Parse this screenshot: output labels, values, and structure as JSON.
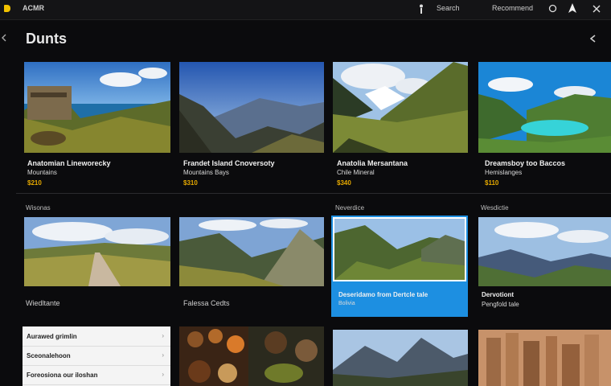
{
  "topbar": {
    "app_name": "ACMR",
    "nav_1": "Search",
    "nav_2": "Recommend"
  },
  "page": {
    "title": "Dunts"
  },
  "row1": [
    {
      "title": "Anatomian Lineworecky",
      "subtitle": "Mountains",
      "price": "$210"
    },
    {
      "title": "Frandet Island Cnoversoty",
      "subtitle": "Mountains Bays",
      "price": "$310"
    },
    {
      "title": "Anatolia Mersantana",
      "subtitle": "Chile Mineral",
      "price": "$340"
    },
    {
      "title": "Dreamsboy too Baccos",
      "subtitle": "Hemislanges",
      "price": "$110"
    }
  ],
  "sections": {
    "s1": "Wisonas",
    "s3": "Neverdice",
    "s4": "Wesdictie"
  },
  "row2": [
    {
      "label": "Wiedltante"
    },
    {
      "label": "Falessa Cedts"
    },
    {
      "title": "Deseridamo from Dertcle tale",
      "subtitle": "Bolivia"
    },
    {
      "title": "Dervotiont",
      "subtitle": "Pengfold tale"
    }
  ],
  "list": [
    {
      "label": "Aurawed grimlin",
      "arrow": "›"
    },
    {
      "label": "Sceonalehoon",
      "arrow": "›"
    },
    {
      "label": "Foreosiona our iloshan",
      "arrow": "›"
    }
  ]
}
